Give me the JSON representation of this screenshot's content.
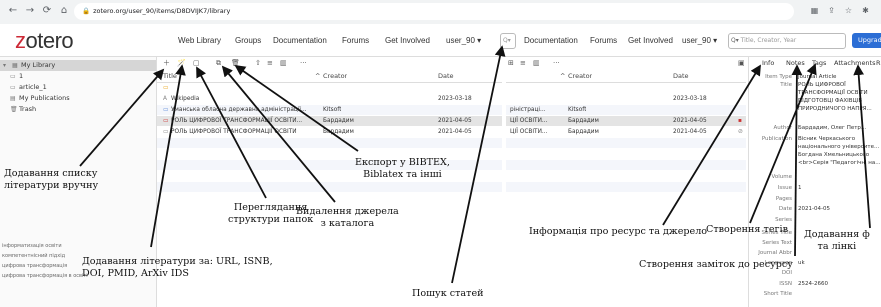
{
  "browser": {
    "url": "zotero.org/user_90/items/D8DVIJK7/library",
    "back_icon": "arrow-left",
    "forward_icon": "arrow-right",
    "reload_icon": "reload"
  },
  "header": {
    "logo_z": "z",
    "logo_rest": "otero",
    "menu": [
      "Web Library",
      "Groups",
      "Documentation",
      "Forums",
      "Get Involved",
      "user_90 ▾"
    ],
    "menu_dup": [
      "Documentation",
      "Forums",
      "Get Involved",
      "user_90 ▾"
    ],
    "search_placeholder": "Title, Creator, Year",
    "upgrade_label": "Upgrad"
  },
  "sidebar": {
    "items": [
      {
        "label": "My Library"
      },
      {
        "label": "1"
      },
      {
        "label": "article_1"
      },
      {
        "label": "My Publications"
      },
      {
        "label": "Trash"
      }
    ],
    "tags": [
      "інформатизація освіти",
      "компетентнісний підхід",
      "цифрова трансформація",
      "цифрова трансформація в освіті"
    ]
  },
  "toolbar": {
    "more_label": "···"
  },
  "columns": {
    "title": "Title",
    "creator": "Creator",
    "date": "Date"
  },
  "items": [
    {
      "title": "",
      "creator": "",
      "date": ""
    },
    {
      "title": "Wikipedia",
      "creator": "",
      "date": "2023-03-18"
    },
    {
      "title": "Уманська обласна державна адміністрації...",
      "creator": "Kitsoft",
      "date": ""
    },
    {
      "title": "РОЛЬ ЦИФРОВОЇ ТРАНСФОРМАЦІЇ ОСВІТИ...",
      "creator": "Бардадим",
      "date": "2021-04-05"
    },
    {
      "title": "РОЛЬ ЦИФРОВОЇ ТРАНСФОРМАЦІЇ ОСВІТИ",
      "creator": "Бардадим",
      "date": "2021-04-05"
    }
  ],
  "items_dup": [
    {
      "title": "",
      "creator": "",
      "date": ""
    },
    {
      "title": "",
      "creator": "",
      "date": "2023-03-18"
    },
    {
      "title": "ріністраці...",
      "creator": "Kitsoft",
      "date": ""
    },
    {
      "title": "ЦІЇ ОСВІТИ...",
      "creator": "Бардадим",
      "date": "2021-04-05"
    },
    {
      "title": "ЦІЇ ОСВІТИ...",
      "creator": "Бардадим",
      "date": "2021-04-05"
    }
  ],
  "info_tabs": [
    "Info",
    "Notes",
    "Tags",
    "Attachments",
    "R"
  ],
  "info": {
    "item_type_label": "Item Type",
    "item_type_value": "Journal Article",
    "title_label": "Title",
    "title_lines": [
      "РОЛЬ ЦИФРОВОЇ",
      "ТРАНСФОРМАЦІЇ ОСВІТИ",
      "ПІДГОТОВЦІ ФАХІВЦІВ",
      "ПРИРОДНИЧОГО НАПРЯ..."
    ],
    "author_label": "Author",
    "author_value": "Бардадим, Олег Петр...",
    "publication_label": "Publication",
    "publication_lines": [
      "Вісник Черкаського",
      "національного університе...",
      "Богдана Хмельницького",
      "<br>Серія \"Педагогічні на..."
    ],
    "fields": [
      {
        "label": "Volume",
        "value": ""
      },
      {
        "label": "Issue",
        "value": "1"
      },
      {
        "label": "Pages",
        "value": ""
      },
      {
        "label": "Date",
        "value": "2021-04-05"
      },
      {
        "label": "Series",
        "value": ""
      },
      {
        "label": "Series Title",
        "value": ""
      },
      {
        "label": "Series Text",
        "value": ""
      },
      {
        "label": "Journal Abbr",
        "value": ""
      },
      {
        "label": "Language",
        "value": "uk"
      },
      {
        "label": "DOI",
        "value": ""
      },
      {
        "label": "ISSN",
        "value": "2524-2660"
      },
      {
        "label": "Short Title",
        "value": ""
      }
    ]
  },
  "annotations": {
    "add_list": [
      "Додавання списку",
      "літератури вручну"
    ],
    "add_by_id": [
      "Додавання літератури за: URL, ISNB,",
      "DOI, PMID, ArXiv IDS"
    ],
    "view_folders": [
      "Переглядання",
      "структури папок"
    ],
    "delete_source": [
      "Видалення джерела",
      "з каталога"
    ],
    "export": [
      "Експорт у BIBTEX,",
      "Biblatex  та інші"
    ],
    "search_articles": [
      "Пошук статей"
    ],
    "resource_info": [
      "Інформація про ресурс та джерело"
    ],
    "create_tags": [
      "Створення тегів"
    ],
    "create_notes": [
      "Створення заміток до ресурсу"
    ],
    "add_files": [
      "Додавання ф",
      "та лінкі"
    ]
  },
  "colors": {
    "logo_accent": "#cc2936",
    "upgrade_button": "#2c6ed5",
    "selected_row": "#e4e4e4"
  }
}
